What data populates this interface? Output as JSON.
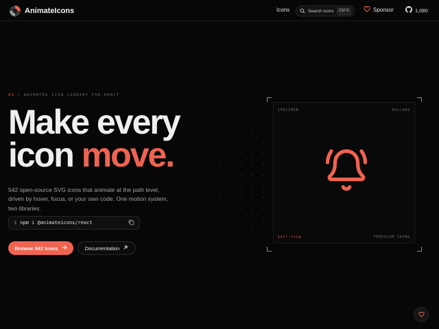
{
  "header": {
    "brand": "AnimateIcons",
    "nav_icons": "Icons",
    "search": {
      "label": "Search icons",
      "shortcut": "Ctrl K"
    },
    "sponsor": "Sponsor",
    "stars": "1,080"
  },
  "hero": {
    "eyebrow_num": "01",
    "eyebrow_text": "/ ANIMATED ICON LIBRARY FOR REACT",
    "title_line1": "Make every",
    "title_line2_plain": "icon ",
    "title_line2_accent": "move.",
    "description": "542 open-source SVG icons that animate at the path level, driven by hover, focus, or your own code. One motion system, two libraries.",
    "command_prompt": "$",
    "command": "npm i @animateicons/react",
    "primary_button": "Browse 542 icons",
    "secondary_button": "Documentation"
  },
  "specimen": {
    "label": "SPECIMEN",
    "count": "001/006",
    "icon_name": "bell-ring",
    "animation": "PENDULUM SWING"
  },
  "colors": {
    "accent": "#ef6351",
    "background": "#070707"
  },
  "icons": [
    "animateicons-logo",
    "search-icon",
    "heart-icon",
    "github-icon",
    "copy-icon",
    "arrow-right-icon",
    "arrow-up-right-icon",
    "bell-ring-icon"
  ]
}
